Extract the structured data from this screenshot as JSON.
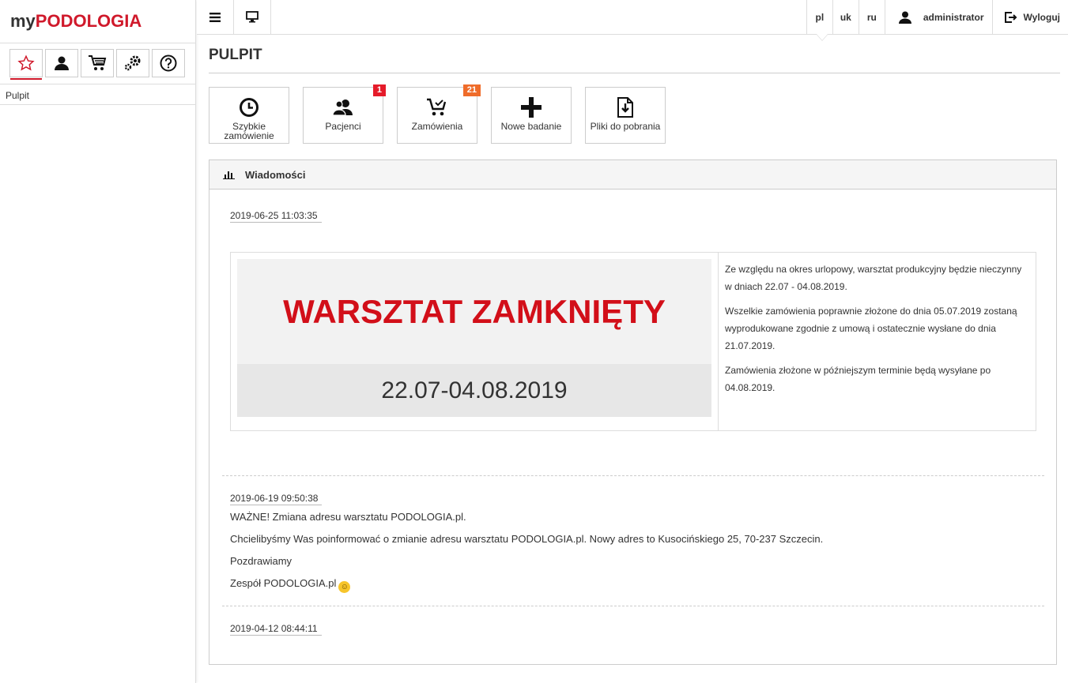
{
  "sidebar": {
    "logo_prefix": "my",
    "logo_brand": "PODOLOGIA",
    "breadcrumb": "Pulpit"
  },
  "topbar": {
    "languages": [
      "pl",
      "uk",
      "ru"
    ],
    "user": "administrator",
    "logout": "Wyloguj"
  },
  "page": {
    "title": "PULPIT"
  },
  "quick": [
    {
      "label": "Szybkie zamówienie",
      "icon": "clock-icon",
      "badge": ""
    },
    {
      "label": "Pacjenci",
      "icon": "patients-icon",
      "badge": "1"
    },
    {
      "label": "Zamówienia",
      "icon": "cart-icon",
      "badge": "21"
    },
    {
      "label": "Nowe badanie",
      "icon": "plus-icon",
      "badge": ""
    },
    {
      "label": "Pliki do pobrania",
      "icon": "download-file-icon",
      "badge": ""
    }
  ],
  "news": {
    "title": "Wiadomości",
    "items": [
      {
        "date": "2019-06-25 11:03:35",
        "image_title": "WARSZTAT ZAMKNIĘTY",
        "image_dates": "22.07-04.08.2019",
        "paragraphs": [
          "Ze względu na okres urlopowy, warsztat produkcyjny będzie nieczynny w dniach 22.07 - 04.08.2019.",
          "Wszelkie zamówienia poprawnie złożone do dnia 05.07.2019 zostaną wyprodukowane zgodnie z umową i ostatecznie wysłane do dnia 21.07.2019.",
          "Zamówienia złożone w późniejszym terminie będą wysyłane po 04.08.2019."
        ]
      },
      {
        "date": "2019-06-19 09:50:38",
        "paragraphs": [
          "WAŻNE! Zmiana adresu warsztatu PODOLOGIA.pl.",
          "Chcielibyśmy Was poinformować o zmianie adresu warsztatu PODOLOGIA.pl. Nowy adres to Kusocińskiego 25, 70-237 Szczecin.",
          "Pozdrawiamy",
          "Zespół PODOLOGIA.pl"
        ]
      },
      {
        "date": "2019-04-12 08:44:11"
      }
    ]
  },
  "colors": {
    "accent": "#d0192b",
    "badge_red": "#e51c2a",
    "badge_orange": "#ef6c2a"
  }
}
